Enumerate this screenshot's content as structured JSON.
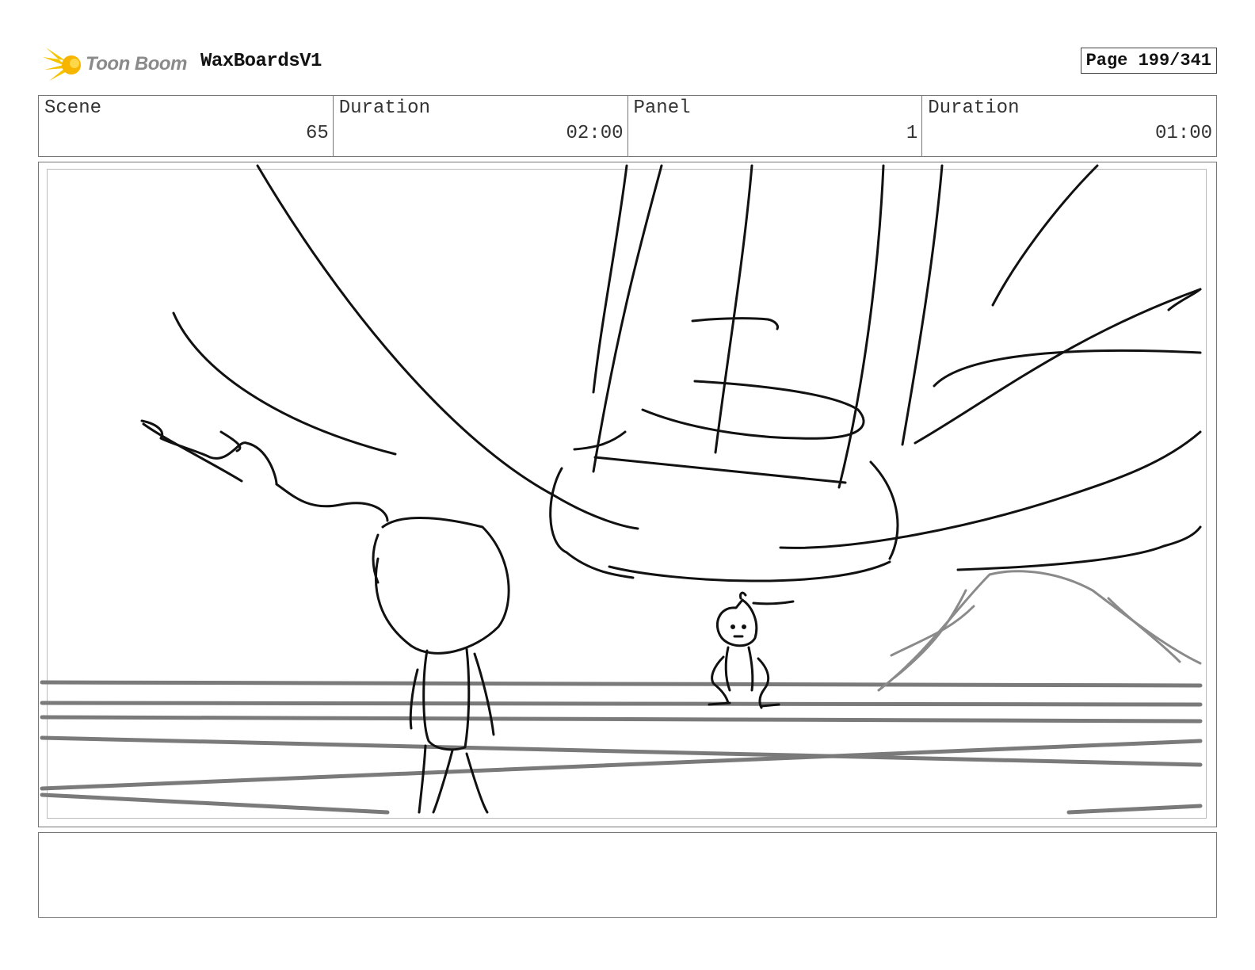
{
  "header": {
    "logo_text": "Toon Boom",
    "project_title": "WaxBoardsV1",
    "page_label": "Page 199/341"
  },
  "info": {
    "scene_label": "Scene",
    "scene_value": "65",
    "scene_duration_label": "Duration",
    "scene_duration_value": "02:00",
    "panel_label": "Panel",
    "panel_value": "1",
    "panel_duration_label": "Duration",
    "panel_duration_value": "01:00"
  },
  "notes": {
    "text": ""
  },
  "colors": {
    "sketch_black": "#111111",
    "sketch_gray": "#7a7a7a",
    "logo_yellow": "#f5c400"
  }
}
